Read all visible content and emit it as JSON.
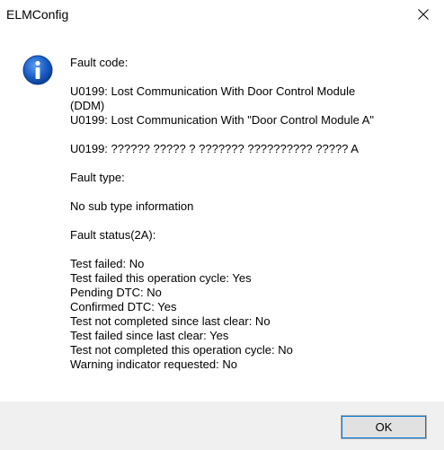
{
  "window": {
    "title": "ELMConfig"
  },
  "icons": {
    "dialog_icon": "information-icon",
    "close_icon": "close-icon"
  },
  "colors": {
    "info_icon_blue": "#1c60c8",
    "button_focus": "#0078d7",
    "footer_bg": "#f0f0f0"
  },
  "message": {
    "lines": [
      "Fault code:",
      "",
      "U0199: Lost Communication With Door Control Module",
      "(DDM)",
      "U0199: Lost Communication With \"Door Control Module A\"",
      "",
      "U0199: ?????? ????? ? ??????? ?????????? ????? A",
      "",
      "Fault type:",
      "",
      "No sub type information",
      "",
      "Fault status(2A):",
      "",
      "Test failed: No",
      "Test failed this operation cycle: Yes",
      "Pending DTC: No",
      "Confirmed DTC: Yes",
      "Test not completed since last clear: No",
      "Test failed since last clear: Yes",
      "Test not completed this operation cycle: No",
      "Warning indicator requested: No"
    ]
  },
  "buttons": {
    "ok_label": "OK"
  }
}
